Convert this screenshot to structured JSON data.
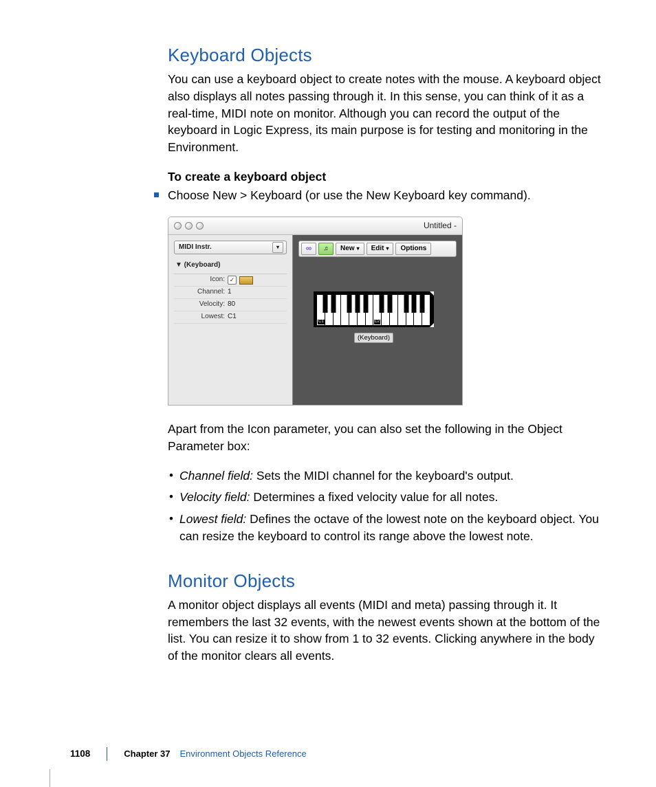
{
  "sections": {
    "keyboard": {
      "heading": "Keyboard Objects",
      "intro": "You can use a keyboard object to create notes with the mouse. A keyboard object also displays all notes passing through it. In this sense, you can think of it as a real-time, MIDI note on monitor. Although you can record the output of the keyboard in Logic Express, its main purpose is for testing and monitoring in the Environment.",
      "task_title": "To create a keyboard object",
      "step": "Choose New > Keyboard (or use the New Keyboard key command).",
      "after_figure": "Apart from the Icon parameter, you can also set the following in the Object Parameter box:",
      "bullets": [
        {
          "term": "Channel field:",
          "desc": "  Sets the MIDI channel for the keyboard's output."
        },
        {
          "term": "Velocity field:",
          "desc": "  Determines a fixed velocity value for all notes."
        },
        {
          "term": "Lowest field:",
          "desc": "  Defines the octave of the lowest note on the keyboard object. You can resize the keyboard to control its range above the lowest note."
        }
      ]
    },
    "monitor": {
      "heading": "Monitor Objects",
      "body": "A monitor object displays all events (MIDI and meta) passing through it. It remembers the last 32 events, with the newest events shown at the bottom of the list. You can resize it to show from 1 to 32 events. Clicking anywhere in the body of the monitor clears all events."
    }
  },
  "figure": {
    "window_title": "Untitled -",
    "sidebar": {
      "selector": "MIDI Instr.",
      "header": "▼ (Keyboard)",
      "params": {
        "icon_label": "Icon:",
        "channel_label": "Channel:",
        "channel_value": "1",
        "velocity_label": "Velocity:",
        "velocity_value": "80",
        "lowest_label": "Lowest:",
        "lowest_value": "C1"
      }
    },
    "toolbar": {
      "new": "New",
      "edit": "Edit",
      "options": "Options"
    },
    "keyboard_caption": "(Keyboard)",
    "octaves": {
      "c1": "C1",
      "c2": "C2"
    }
  },
  "footer": {
    "page": "1108",
    "chapter_label": "Chapter 37",
    "chapter_title": "Environment Objects Reference"
  }
}
